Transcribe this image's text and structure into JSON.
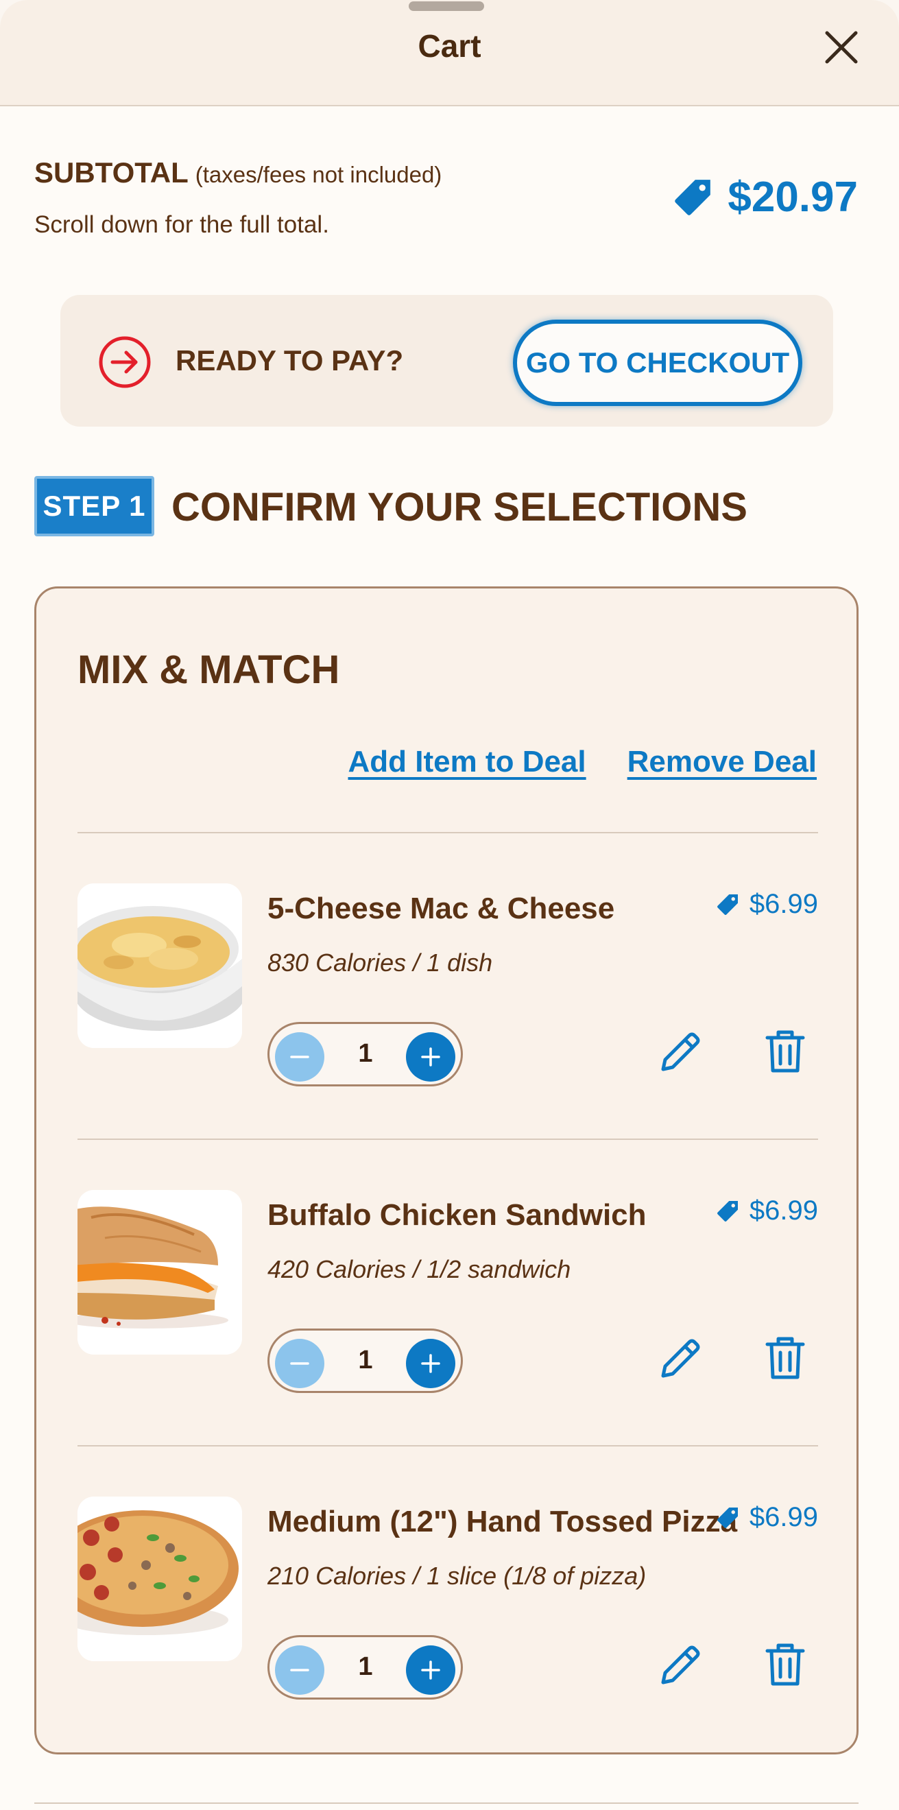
{
  "header": {
    "title": "Cart"
  },
  "subtotal": {
    "label": "SUBTOTAL",
    "note": "(taxes/fees not included)",
    "scroll_note": "Scroll down for the full total.",
    "amount": "$20.97"
  },
  "pay_panel": {
    "ready_text": "READY TO PAY?",
    "checkout_label": "GO TO CHECKOUT"
  },
  "step": {
    "badge": "STEP 1",
    "title": "CONFIRM YOUR SELECTIONS"
  },
  "deal": {
    "title": "MIX & MATCH",
    "add_item_label": "Add Item to Deal",
    "remove_label": "Remove Deal",
    "items": [
      {
        "name": "5-Cheese Mac & Cheese",
        "calories": "830 Calories / 1 dish",
        "price": "$6.99",
        "quantity": "1",
        "image_icon": "mac-and-cheese-image"
      },
      {
        "name": "Buffalo Chicken Sandwich",
        "calories": "420 Calories / 1/2 sandwich",
        "price": "$6.99",
        "quantity": "1",
        "image_icon": "sandwich-image"
      },
      {
        "name": "Medium (12\") Hand Tossed Pizza",
        "calories": "210 Calories / 1 slice (1/8 of pizza)",
        "price": "$6.99",
        "quantity": "1",
        "image_icon": "pizza-image"
      }
    ]
  },
  "colors": {
    "accent_blue": "#0d79c4",
    "brown_text": "#5a3214",
    "alert_red": "#e3202b",
    "background": "#fefbf7"
  }
}
